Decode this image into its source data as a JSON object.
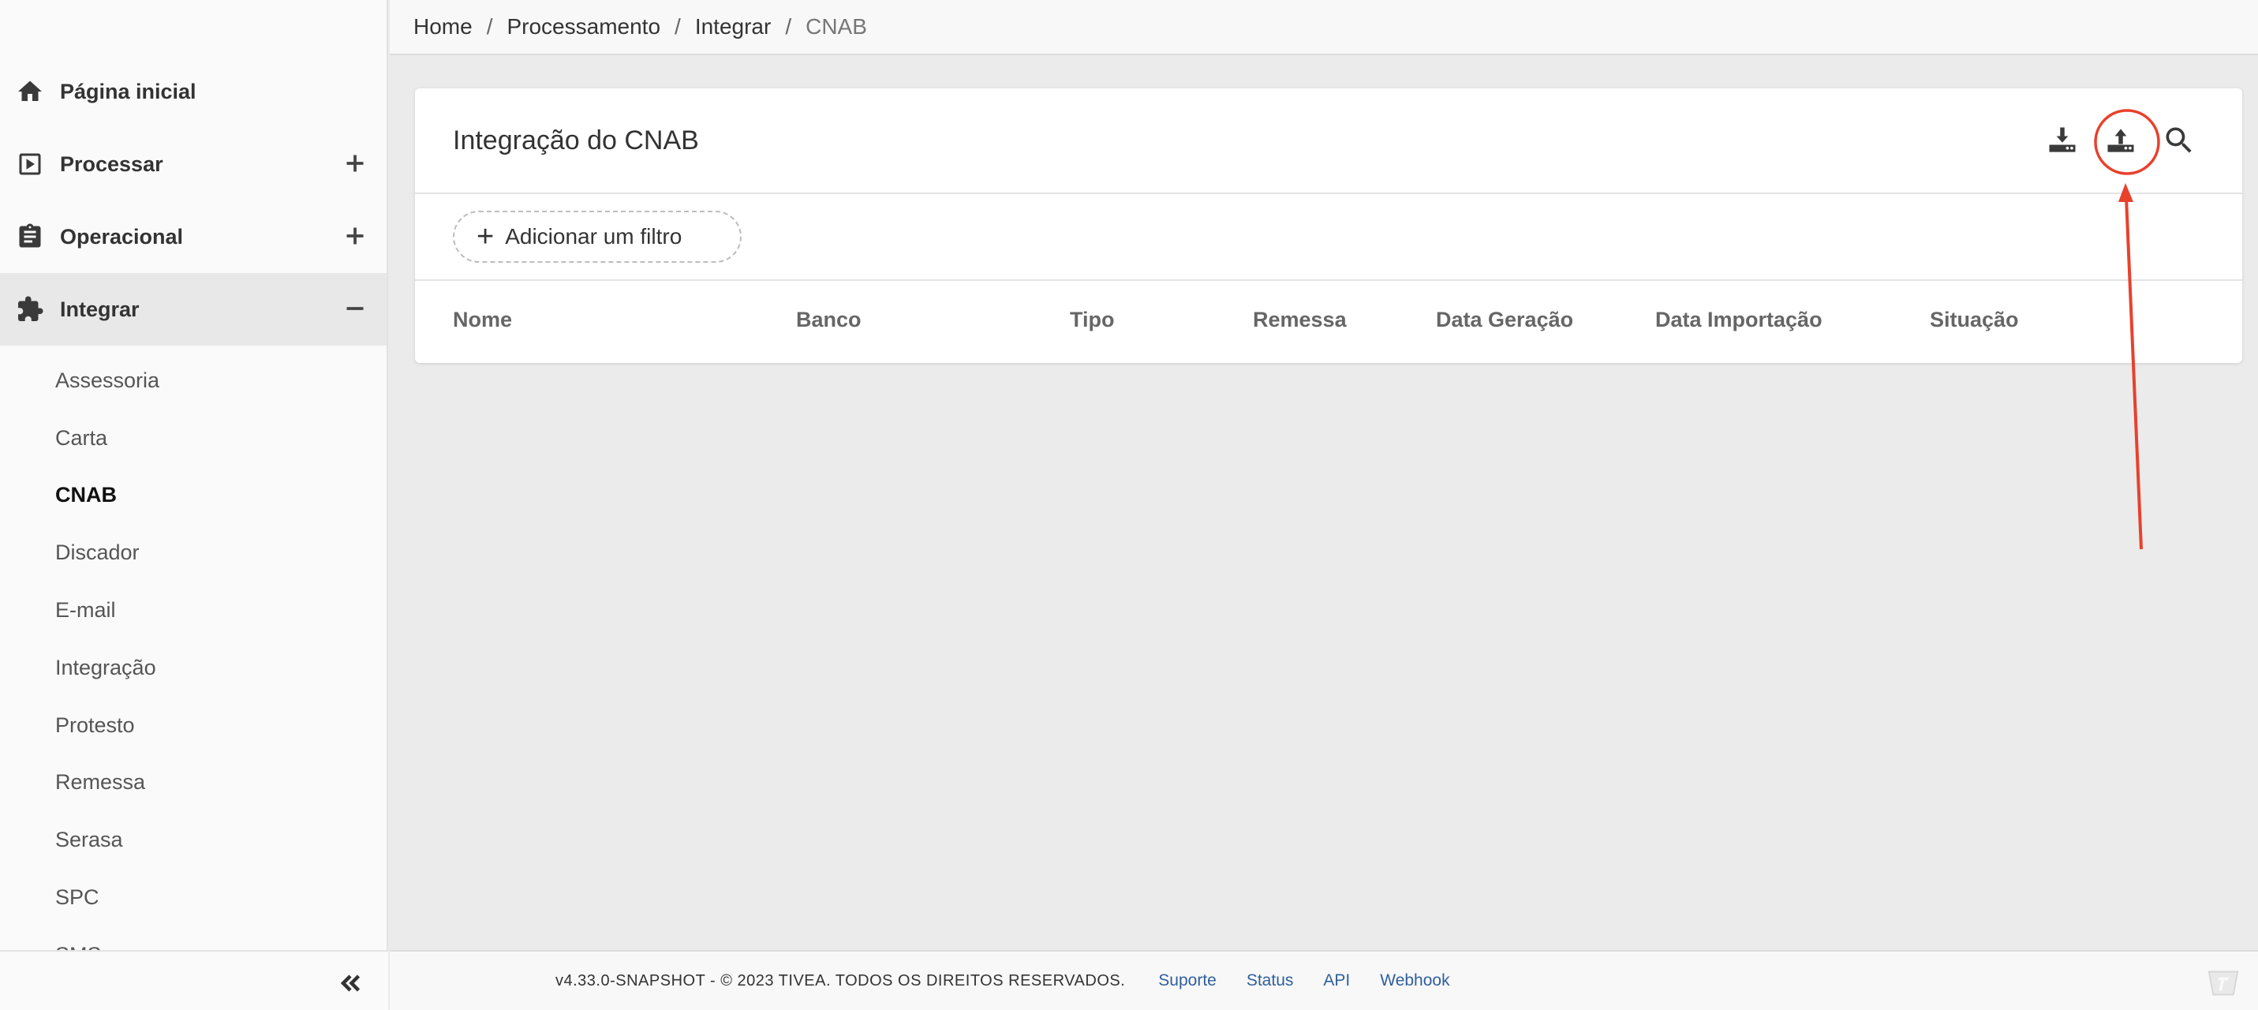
{
  "breadcrumb": [
    "Home",
    "Processamento",
    "Integrar",
    "CNAB"
  ],
  "sidebar": {
    "main_items": [
      {
        "label": "Página inicial",
        "icon": "home-icon"
      },
      {
        "label": "Processar",
        "icon": "play-box-icon",
        "toggle": "plus-icon"
      },
      {
        "label": "Operacional",
        "icon": "clipboard-icon",
        "toggle": "plus-icon"
      },
      {
        "label": "Integrar",
        "icon": "puzzle-icon",
        "toggle": "minus-icon",
        "expanded": true
      }
    ],
    "sub_items": [
      "Assessoria",
      "Carta",
      "CNAB",
      "Discador",
      "E-mail",
      "Integração",
      "Protesto",
      "Remessa",
      "Serasa",
      "SPC",
      "SMS"
    ],
    "selected_sub_item": "CNAB",
    "collapse_icon": "double-chevron-left-icon"
  },
  "card": {
    "title": "Integração do CNAB",
    "actions": [
      "download-icon",
      "upload-icon",
      "search-icon"
    ],
    "filter_button": "Adicionar um filtro",
    "columns": [
      "Nome",
      "Banco",
      "Tipo",
      "Remessa",
      "Data Geração",
      "Data Importação",
      "Situação"
    ]
  },
  "annotation": {
    "color": "#e8412c",
    "target": "upload-icon"
  },
  "footer": {
    "copyright": "v4.33.0-SNAPSHOT - © 2023 TIVEA. TODOS OS DIREITOS RESERVADOS.",
    "links": [
      "Suporte",
      "Status",
      "API",
      "Webhook"
    ]
  }
}
